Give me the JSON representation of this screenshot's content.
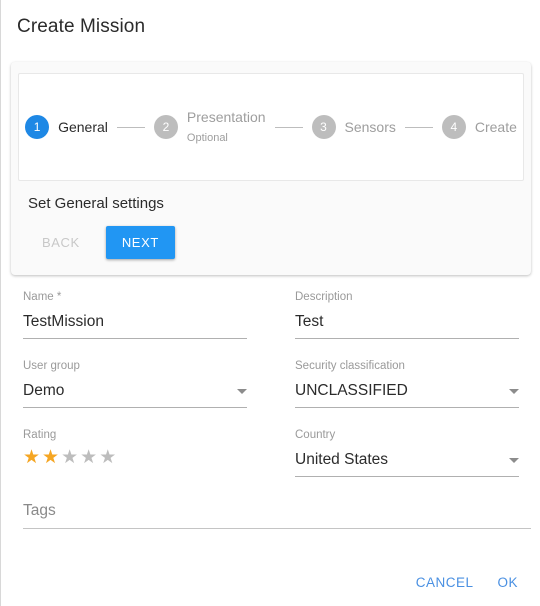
{
  "dialog": {
    "title": "Create Mission"
  },
  "stepper": {
    "steps": [
      {
        "number": "1",
        "label": "General",
        "sublabel": "",
        "state": "active"
      },
      {
        "number": "2",
        "label": "Presentation",
        "sublabel": "Optional",
        "state": "inactive"
      },
      {
        "number": "3",
        "label": "Sensors",
        "sublabel": "",
        "state": "inactive"
      },
      {
        "number": "4",
        "label": "Create",
        "sublabel": "",
        "state": "inactive"
      }
    ],
    "body_title": "Set General settings",
    "back_label": "BACK",
    "next_label": "NEXT"
  },
  "form": {
    "name": {
      "label": "Name *",
      "value": "TestMission"
    },
    "description": {
      "label": "Description",
      "value": "Test"
    },
    "user_group": {
      "label": "User group",
      "value": "Demo",
      "icon": "chevron-down-icon"
    },
    "security_classification": {
      "label": "Security classification",
      "value": "UNCLASSIFIED",
      "icon": "chevron-down-icon"
    },
    "rating": {
      "label": "Rating",
      "value": 2,
      "max": 5,
      "stars": [
        {
          "glyph": "★",
          "filled": true
        },
        {
          "glyph": "★",
          "filled": true
        },
        {
          "glyph": "★",
          "filled": false
        },
        {
          "glyph": "★",
          "filled": false
        },
        {
          "glyph": "★",
          "filled": false
        }
      ]
    },
    "country": {
      "label": "Country",
      "value": "United States",
      "icon": "chevron-down-icon"
    },
    "tags": {
      "label": "",
      "placeholder": "Tags",
      "value": ""
    }
  },
  "footer": {
    "cancel_label": "CANCEL",
    "ok_label": "OK"
  },
  "colors": {
    "accent": "#2196f3",
    "step_active": "#1e88e5",
    "step_inactive": "#bdbdbd",
    "star_filled": "#f5a623",
    "star_empty": "#bdbdbd",
    "link": "#4a90e2"
  }
}
